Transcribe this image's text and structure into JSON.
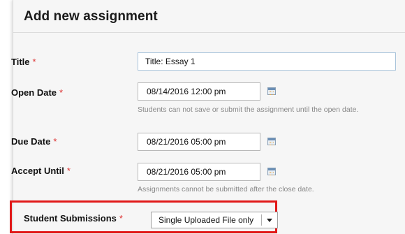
{
  "form": {
    "title": "Add new assignment",
    "required_mark": "*",
    "fields": {
      "title": {
        "label": "Title",
        "value": "Title: Essay 1"
      },
      "open_date": {
        "label": "Open Date",
        "value": "08/14/2016 12:00 pm",
        "help": "Students can not save or submit the assignment until the open date."
      },
      "due_date": {
        "label": "Due Date",
        "value": "08/21/2016 05:00 pm"
      },
      "accept_until": {
        "label": "Accept Until",
        "value": "08/21/2016 05:00 pm",
        "help": "Assignments cannot be submitted after the close date."
      },
      "student_submissions": {
        "label": "Student Submissions",
        "selected": "Single Uploaded File only"
      }
    }
  },
  "icons": {
    "calendar": "calendar-icon",
    "dropdown": "chevron-down-icon"
  },
  "colors": {
    "required": "#d33333",
    "highlight": "#e11919",
    "input_border": "#a9c4db"
  }
}
